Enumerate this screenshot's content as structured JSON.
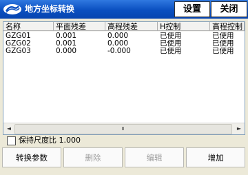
{
  "window": {
    "title": "地方坐标转换",
    "settings_label": "设置",
    "close_label": "关闭",
    "title_bg": "#0a4fc0",
    "icon": "app-logo-icon"
  },
  "table": {
    "columns": [
      "名称",
      "平面残差",
      "高程残差",
      "H控制",
      "高程控制"
    ],
    "rows": [
      [
        "GZG01",
        "0.001",
        "0.000",
        "已使用",
        "已使用"
      ],
      [
        "GZG02",
        "0.001",
        "0.000",
        "已使用",
        "已使用"
      ],
      [
        "GZG03",
        "0.000",
        "-0.000",
        "已使用",
        "已使用"
      ]
    ]
  },
  "scrollbar": {
    "left": "◄",
    "grip": "III",
    "right": "►"
  },
  "options": {
    "keep_scale_label": "保持尺度比 1.000",
    "keep_scale_checked": false
  },
  "buttons": {
    "transform_params": "转换参数",
    "delete": "删除",
    "edit": "编辑",
    "add": "增加"
  }
}
